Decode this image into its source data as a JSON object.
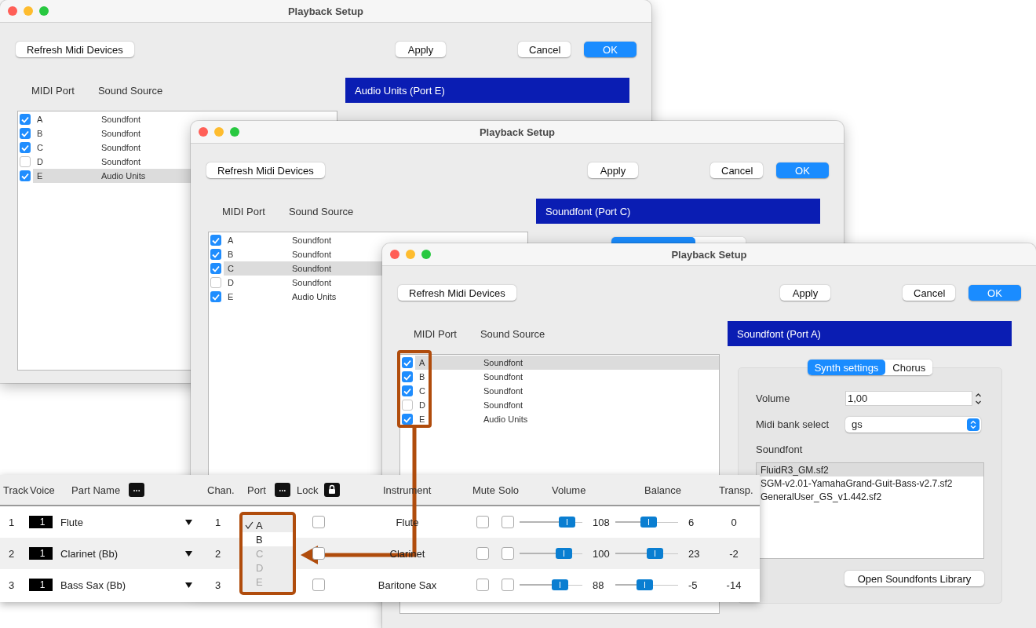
{
  "windows": [
    {
      "title": "Playback Setup",
      "buttons": {
        "refresh": "Refresh Midi Devices",
        "apply": "Apply",
        "cancel": "Cancel",
        "ok": "OK"
      },
      "columns": [
        "MIDI Port",
        "Sound Source"
      ],
      "ports": [
        {
          "port": "A",
          "source": "Soundfont",
          "checked": true,
          "selected": false
        },
        {
          "port": "B",
          "source": "Soundfont",
          "checked": true,
          "selected": false
        },
        {
          "port": "C",
          "source": "Soundfont",
          "checked": true,
          "selected": false
        },
        {
          "port": "D",
          "source": "Soundfont",
          "checked": false,
          "selected": false
        },
        {
          "port": "E",
          "source": "Audio Units",
          "checked": true,
          "selected": true
        }
      ],
      "panel": {
        "title": "Audio Units (Port E)"
      }
    },
    {
      "title": "Playback Setup",
      "buttons": {
        "refresh": "Refresh Midi Devices",
        "apply": "Apply",
        "cancel": "Cancel",
        "ok": "OK"
      },
      "columns": [
        "MIDI Port",
        "Sound Source"
      ],
      "ports": [
        {
          "port": "A",
          "source": "Soundfont",
          "checked": true,
          "selected": false
        },
        {
          "port": "B",
          "source": "Soundfont",
          "checked": true,
          "selected": false
        },
        {
          "port": "C",
          "source": "Soundfont",
          "checked": true,
          "selected": true
        },
        {
          "port": "D",
          "source": "Soundfont",
          "checked": false,
          "selected": false
        },
        {
          "port": "E",
          "source": "Audio Units",
          "checked": true,
          "selected": false
        }
      ],
      "panel": {
        "title": "Soundfont (Port C)",
        "tabs": [
          {
            "selected": true
          },
          {
            "selected": false
          }
        ]
      }
    },
    {
      "title": "Playback Setup",
      "buttons": {
        "refresh": "Refresh Midi Devices",
        "apply": "Apply",
        "cancel": "Cancel",
        "ok": "OK"
      },
      "columns": [
        "MIDI Port",
        "Sound Source"
      ],
      "ports": [
        {
          "port": "A",
          "source": "Soundfont",
          "checked": true,
          "selected": true
        },
        {
          "port": "B",
          "source": "Soundfont",
          "checked": true,
          "selected": false
        },
        {
          "port": "C",
          "source": "Soundfont",
          "checked": true,
          "selected": false
        },
        {
          "port": "D",
          "source": "Soundfont",
          "checked": false,
          "selected": false
        },
        {
          "port": "E",
          "source": "Audio Units",
          "checked": true,
          "selected": false
        }
      ],
      "panel": {
        "title": "Soundfont (Port A)",
        "tabs": [
          {
            "label": "Synth settings",
            "selected": true
          },
          {
            "label": "Chorus",
            "selected": false
          }
        ],
        "fields": [
          {
            "kind": "spinner",
            "label": "Volume",
            "value": "1,00"
          },
          {
            "kind": "select",
            "label": "Midi bank select",
            "value": "gs"
          }
        ],
        "soundfont_label": "Soundfont",
        "soundfonts": [
          {
            "name": "FluidR3_GM.sf2",
            "selected": true
          },
          {
            "name": "SGM-v2.01-YamahaGrand-Guit-Bass-v2.7.sf2",
            "selected": false
          },
          {
            "name": "GeneralUser_GS_v1.442.sf2",
            "selected": false
          }
        ],
        "library_button": "Open Soundfonts Library"
      }
    }
  ],
  "mixer": {
    "columns": [
      {
        "label": "Track",
        "kind": "plain"
      },
      {
        "label": "Voice",
        "kind": "plain"
      },
      {
        "label": "Part Name",
        "kind": "menu",
        "button": "..."
      },
      {
        "label": "Chan.",
        "kind": "plain"
      },
      {
        "label": "Port",
        "kind": "menu",
        "button": "..."
      },
      {
        "label": "Lock",
        "kind": "lock"
      },
      {
        "label": "Instrument",
        "kind": "plain"
      },
      {
        "label": "Mute",
        "kind": "plain"
      },
      {
        "label": "Solo",
        "kind": "plain"
      },
      {
        "label": "Volume",
        "kind": "plain"
      },
      {
        "label": "Balance",
        "kind": "plain"
      },
      {
        "label": "Transp.",
        "kind": "plain"
      }
    ],
    "rows": [
      {
        "track": "1",
        "voice": "1",
        "part": "Flute",
        "chan": "1",
        "locked": false,
        "instrument": "Flute",
        "mute": false,
        "solo": false,
        "volume": {
          "level": 0.75,
          "reading": "108"
        },
        "balance": {
          "level": 0.53,
          "reading": "6"
        },
        "transp": "0"
      },
      {
        "track": "2",
        "voice": "1",
        "part": "Clarinet (Bb)",
        "chan": "2",
        "locked": false,
        "instrument": "Clarinet",
        "mute": false,
        "solo": false,
        "volume": {
          "level": 0.7,
          "reading": "100"
        },
        "balance": {
          "level": 0.63,
          "reading": "23"
        },
        "transp": "-2"
      },
      {
        "track": "3",
        "voice": "1",
        "part": "Bass Sax (Bb)",
        "chan": "3",
        "locked": false,
        "instrument": "Baritone Sax",
        "mute": false,
        "solo": false,
        "volume": {
          "level": 0.64,
          "reading": "88"
        },
        "balance": {
          "level": 0.47,
          "reading": "-5"
        },
        "transp": "-14"
      }
    ],
    "port_menu": [
      {
        "label": "A",
        "selected": true,
        "highlighted": false,
        "disabled": false
      },
      {
        "label": "B",
        "selected": false,
        "highlighted": true,
        "disabled": false
      },
      {
        "label": "C",
        "selected": false,
        "highlighted": false,
        "disabled": true
      },
      {
        "label": "D",
        "selected": false,
        "highlighted": false,
        "disabled": true
      },
      {
        "label": "E",
        "selected": false,
        "highlighted": false,
        "disabled": true
      }
    ]
  }
}
